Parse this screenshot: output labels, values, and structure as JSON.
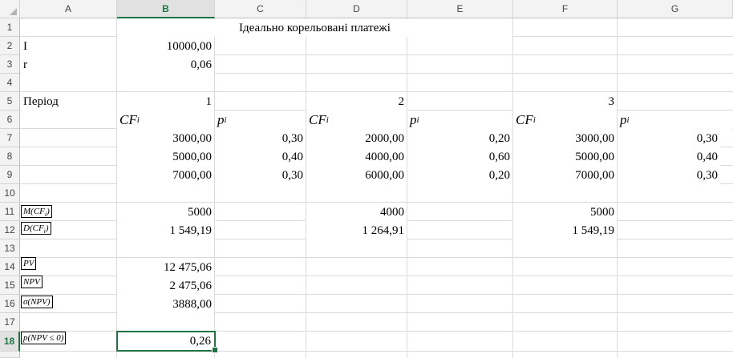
{
  "columns": [
    "A",
    "B",
    "C",
    "D",
    "E",
    "F",
    "G"
  ],
  "rows": [
    "1",
    "2",
    "3",
    "4",
    "5",
    "6",
    "7",
    "8",
    "9",
    "10",
    "11",
    "12",
    "13",
    "14",
    "15",
    "16",
    "17",
    "18"
  ],
  "title": "Ідеально корельовані платежі",
  "params": {
    "I_label": "I",
    "I_value": "10000,00",
    "r_label": "r",
    "r_value": "0,06"
  },
  "period": {
    "label": "Період",
    "p1": "1",
    "p2": "2",
    "p3": "3"
  },
  "headers6": {
    "cf": "CF",
    "cf_sub": "i",
    "p": "p",
    "p_sub": "i"
  },
  "table": {
    "r7": {
      "b": "3000,00",
      "c": "0,30",
      "d": "2000,00",
      "e": "0,20",
      "f": "3000,00",
      "g": "0,30"
    },
    "r8": {
      "b": "5000,00",
      "c": "0,40",
      "d": "4000,00",
      "e": "0,60",
      "f": "5000,00",
      "g": "0,40"
    },
    "r9": {
      "b": "7000,00",
      "c": "0,30",
      "d": "6000,00",
      "e": "0,20",
      "f": "7000,00",
      "g": "0,30"
    }
  },
  "stats": {
    "m_label": "M(CF",
    "m_sub": "i",
    "m_tail": ")",
    "m_b": "5000",
    "m_d": "4000",
    "m_f": "5000",
    "d_label": "D(CF",
    "d_sub": "i",
    "d_tail": ")",
    "d_b": "1 549,19",
    "d_d": "1 264,91",
    "d_f": "1 549,19"
  },
  "results": {
    "pv_label": "PV",
    "pv_value": "12 475,06",
    "npv_label": "NPV",
    "npv_value": "2 475,06",
    "sigma_label": "σ(NPV)",
    "sigma_value": "3888,00",
    "prob_label": "p(NPV ≤ 0)",
    "prob_value": "0,26"
  },
  "selection": {
    "cell": "B18"
  }
}
